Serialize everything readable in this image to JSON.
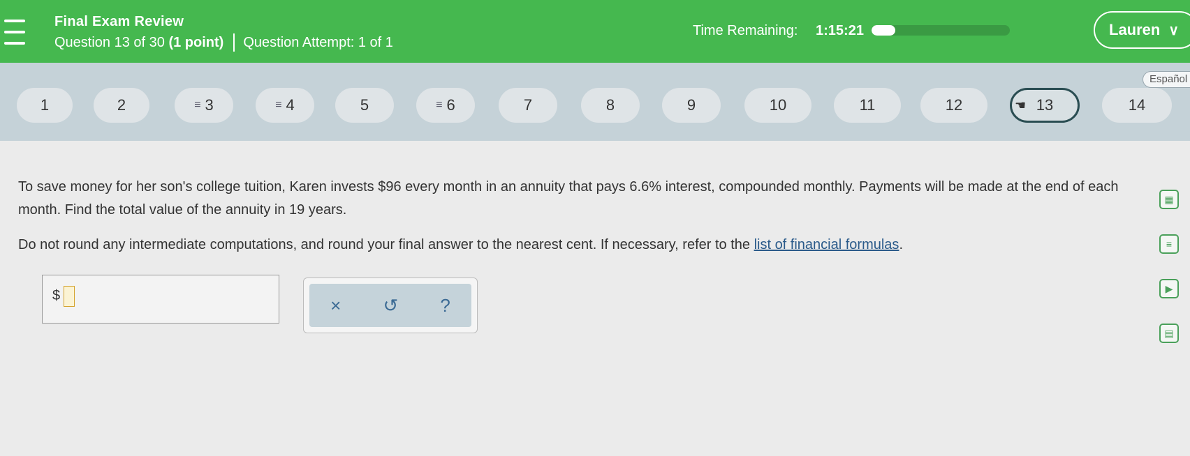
{
  "header": {
    "title": "Final Exam Review",
    "question_info": "Question 13 of 30",
    "point_info": "(1 point)",
    "attempt_info": "Question Attempt: 1 of 1",
    "timer_label": "Time Remaining:",
    "timer_value": "1:15:21",
    "timer_progress_fraction": 0.17,
    "user_name": "Lauren",
    "user_chevron": "∨"
  },
  "nav": {
    "language_label": "Español",
    "questions": [
      {
        "label": "1",
        "flagged": false
      },
      {
        "label": "2",
        "flagged": false
      },
      {
        "label": "3",
        "flagged": true
      },
      {
        "label": "4",
        "flagged": true
      },
      {
        "label": "5",
        "flagged": false
      },
      {
        "label": "6",
        "flagged": true
      },
      {
        "label": "7",
        "flagged": false
      },
      {
        "label": "8",
        "flagged": false
      },
      {
        "label": "9",
        "flagged": false
      },
      {
        "label": "10",
        "flagged": false
      },
      {
        "label": "11",
        "flagged": false
      },
      {
        "label": "12",
        "flagged": false
      },
      {
        "label": "13",
        "flagged": false,
        "current": true
      },
      {
        "label": "14",
        "flagged": false
      }
    ]
  },
  "question": {
    "prompt": "To save money for her son's college tuition, Karen invests $96 every month in an annuity that pays 6.6% interest, compounded monthly. Payments will be made at the end of each month. Find the total value of the annuity in 19 years.",
    "instructions_prefix": "Do not round any intermediate computations, and round your final answer to the nearest cent. If necessary, refer to the ",
    "formula_link": "list of financial formulas",
    "instructions_suffix": ".",
    "answer_prefix": "$",
    "answer_value": ""
  },
  "tools": {
    "clear": "×",
    "undo": "↺",
    "help": "?"
  },
  "side_icons": [
    "calculator-icon",
    "notes-icon",
    "video-icon",
    "textbook-icon"
  ],
  "colors": {
    "header_green": "#45b84f",
    "nav_bg": "#c5d2d8",
    "link_blue": "#2a5a8a"
  }
}
